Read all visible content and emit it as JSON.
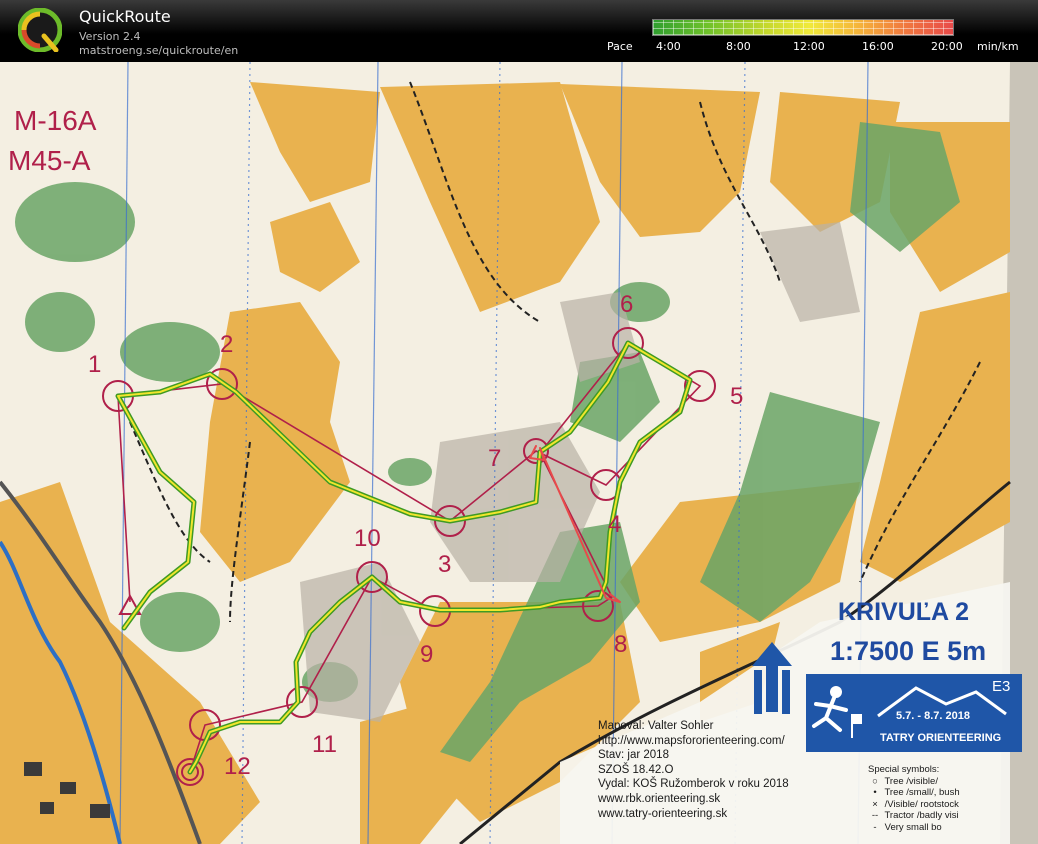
{
  "app": {
    "title": "QuickRoute",
    "version": "Version 2.4",
    "url": "matstroeng.se/quickroute/en",
    "logo_letter": "Q"
  },
  "pace_legend": {
    "label": "Pace",
    "ticks": [
      "4:00",
      "8:00",
      "12:00",
      "16:00",
      "20:00"
    ],
    "unit": "min/km",
    "colors": [
      "#2f9e2f",
      "#6ec12a",
      "#f0ea3a",
      "#f0783e",
      "#e84a4a"
    ]
  },
  "map": {
    "course_classes": [
      "M-16A",
      "M45-A"
    ],
    "controls": [
      "1",
      "2",
      "3",
      "4",
      "5",
      "6",
      "7",
      "8",
      "9",
      "10",
      "11",
      "12"
    ],
    "title": "KRIVUĽA 2",
    "scale": "1:7500 E 5m",
    "event_code": "E3",
    "event_dates": "5.7. - 8.7.  2018",
    "event_name": "TATRY ORIENTEERING",
    "credits": [
      "Mapoval:  Valter Sohler",
      "http://www.mapsfororienteering.com/",
      "Stav: jar 2018",
      "SZOŠ  18.42.O",
      "Vydal: KOŠ Ružomberok v roku 2018",
      "www.rbk.orienteering.sk",
      "www.tatry-orienteering.sk"
    ],
    "special_symbols_title": "Special symbols:",
    "special_symbols": [
      {
        "symbol": "○",
        "label": "Tree /visible/"
      },
      {
        "symbol": "•",
        "label": "Tree /small/, bush"
      },
      {
        "symbol": "×",
        "label": "/Visible/ rootstock"
      },
      {
        "symbol": "--",
        "label": "Tractor /badly visi"
      },
      {
        "symbol": "-",
        "label": "Very small bo"
      }
    ],
    "colors": {
      "open_yellow": "#e9b24f",
      "forest_light": "#f4efe2",
      "green": "#5a9b56",
      "course_magenta": "#b0204a",
      "route_green": "#3f9a24",
      "route_yellow": "#f0e62c",
      "water_blue": "#2d6fc4",
      "panel_blue": "#1f56a8"
    }
  }
}
